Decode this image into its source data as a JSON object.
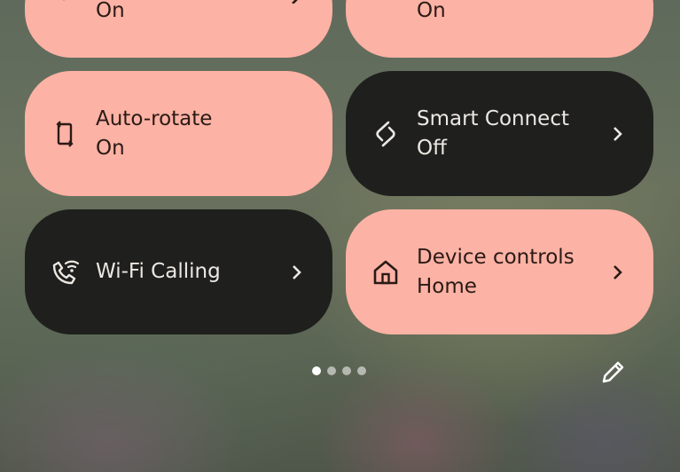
{
  "tiles": [
    {
      "id": "tile-top-left",
      "label": "",
      "status": "On",
      "state": "on",
      "icon": "partial-icon",
      "has_chevron": true
    },
    {
      "id": "tile-top-right",
      "label": "",
      "status": "On",
      "state": "on",
      "icon": "partial-icon",
      "has_chevron": false
    },
    {
      "id": "tile-auto-rotate",
      "label": "Auto-rotate",
      "status": "On",
      "state": "on",
      "icon": "screen-rotate-icon",
      "has_chevron": false
    },
    {
      "id": "tile-smart-connect",
      "label": "Smart Connect",
      "status": "Off",
      "state": "off",
      "icon": "smart-connect-icon",
      "has_chevron": true
    },
    {
      "id": "tile-wifi-calling",
      "label": "Wi-Fi Calling",
      "status": "",
      "state": "off",
      "icon": "wifi-calling-icon",
      "has_chevron": true
    },
    {
      "id": "tile-device-controls",
      "label": "Device controls",
      "status": "Home",
      "state": "on",
      "icon": "home-icon",
      "has_chevron": true
    }
  ],
  "pager": {
    "pages": 4,
    "current_page": 1
  },
  "edit": {
    "icon": "pencil-icon"
  },
  "colors": {
    "tile_on": "#fcb2a4",
    "tile_off": "#1f201d",
    "text_on": "#2a1a16",
    "text_off": "#ece7e2"
  }
}
